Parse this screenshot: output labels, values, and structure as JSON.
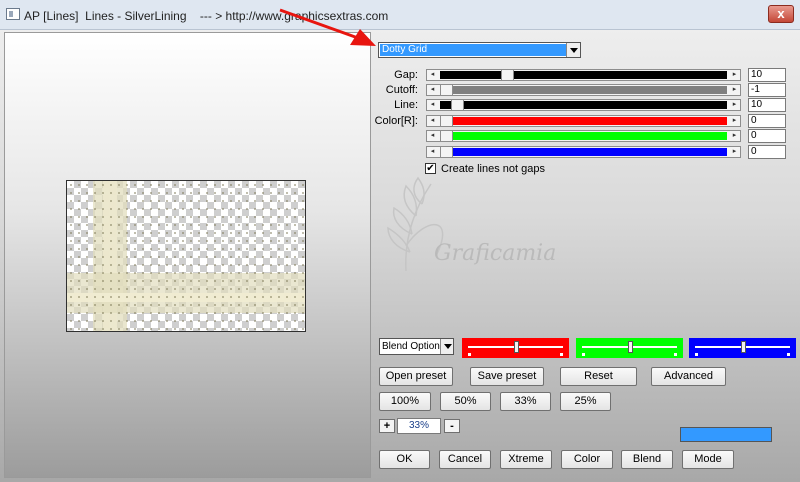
{
  "window": {
    "title": "AP [Lines]  Lines - SilverLining    --- > http://www.graphicsextras.com",
    "close_label": "x"
  },
  "preset": {
    "selected": "Dotty Grid"
  },
  "sliders": [
    {
      "name": "gap",
      "label": "Gap:",
      "value": "10",
      "level": 0.22,
      "fill_color": "#000000"
    },
    {
      "name": "cutoff",
      "label": "Cutoff:",
      "value": "-1",
      "level": 0.0,
      "fill_color": "#808080"
    },
    {
      "name": "line",
      "label": "Line:",
      "value": "10",
      "level": 0.04,
      "fill_color": "#000000"
    },
    {
      "name": "color-r",
      "label": "Color[R]:",
      "value": "0",
      "level": 0.0,
      "fill_color": "#ff0000"
    },
    {
      "name": "color-g",
      "label": "",
      "value": "0",
      "level": 0.0,
      "fill_color": "#00ff00"
    },
    {
      "name": "color-b",
      "label": "",
      "value": "0",
      "level": 0.0,
      "fill_color": "#0000ff"
    }
  ],
  "checkbox": {
    "label": "Create lines not gaps",
    "checked": true,
    "mark": "✔"
  },
  "watermark": {
    "text": "Graficamia"
  },
  "blend": {
    "options_label": "Blend Option",
    "swatches": [
      {
        "color": "#ff0000",
        "level": 0.5
      },
      {
        "color": "#00ff00",
        "level": 0.5
      },
      {
        "color": "#0000ff",
        "level": 0.5
      }
    ]
  },
  "buttons": {
    "open_preset": "Open preset",
    "save_preset": "Save preset",
    "reset": "Reset",
    "advanced": "Advanced",
    "zoom_100": "100%",
    "zoom_50": "50%",
    "zoom_33": "33%",
    "zoom_25": "25%",
    "ok": "OK",
    "cancel": "Cancel",
    "xtreme": "Xtreme",
    "color": "Color",
    "blend": "Blend",
    "mode": "Mode"
  },
  "zoom": {
    "plus": "+",
    "minus": "-",
    "value": "33%"
  },
  "color_swatch": "#3399ff",
  "icons": [
    "window-icon",
    "close-icon",
    "dropdown-arrow-icon",
    "slider-left-arrow-icon",
    "slider-right-arrow-icon",
    "red-arrow-icon",
    "check-icon"
  ]
}
